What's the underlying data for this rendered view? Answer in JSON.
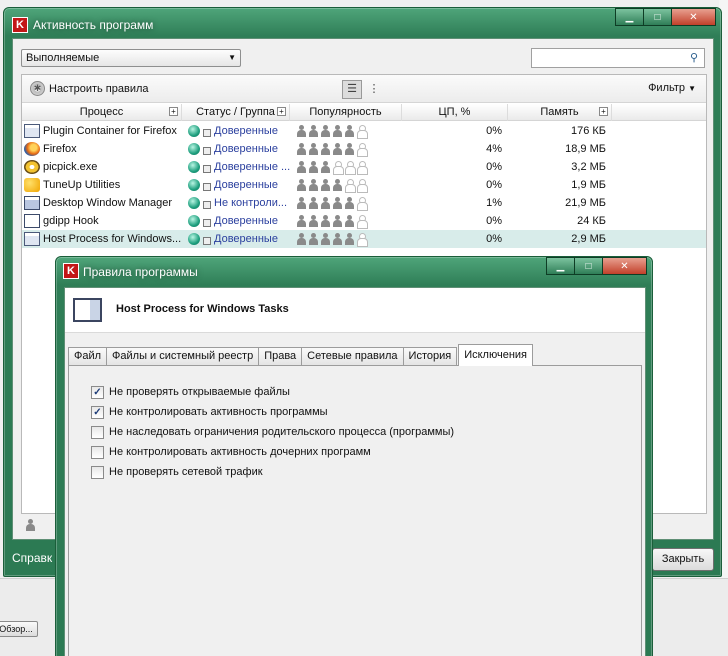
{
  "background": {
    "overview_button": "Обзор..."
  },
  "main_window": {
    "title": "Активность программ",
    "app_icon_letter": "K",
    "view_dropdown": "Выполняемые",
    "search_placeholder": "",
    "toolbar": {
      "rules_button": "Настроить правила",
      "filter_label": "Фильтр"
    },
    "columns": [
      "Процесс",
      "Статус / Группа",
      "Популярность",
      "ЦП, %",
      "Память"
    ],
    "rows": [
      {
        "process": "Plugin Container for Firefox",
        "icon": "doc-icon",
        "status": "Доверенные",
        "popularity": 5,
        "cpu": "0%",
        "memory": "176 КБ"
      },
      {
        "process": "Firefox",
        "icon": "firefox-icon",
        "status": "Доверенные",
        "popularity": 5,
        "cpu": "4%",
        "memory": "18,9 МБ"
      },
      {
        "process": "picpick.exe",
        "icon": "picpick-icon",
        "status": "Доверенные ...",
        "popularity": 3,
        "cpu": "0%",
        "memory": "3,2 МБ"
      },
      {
        "process": "TuneUp Utilities",
        "icon": "tuneup-icon",
        "status": "Доверенные",
        "popularity": 4,
        "cpu": "0%",
        "memory": "1,9 МБ"
      },
      {
        "process": "Desktop Window Manager",
        "icon": "dwm-icon",
        "status": "Не контроли...",
        "popularity": 5,
        "cpu": "1%",
        "memory": "21,9 МБ"
      },
      {
        "process": "gdipp Hook",
        "icon": "window-icon",
        "status": "Доверенные",
        "popularity": 5,
        "cpu": "0%",
        "memory": "24 КБ"
      },
      {
        "process": "Host Process for Windows...",
        "icon": "doc-icon",
        "status": "Доверенные",
        "popularity": 5,
        "cpu": "0%",
        "memory": "2,9 МБ"
      }
    ],
    "help_label": "Справк",
    "close_button": "Закрыть"
  },
  "dialog": {
    "title": "Правила программы",
    "app_name": "Host Process for Windows Tasks",
    "tabs": [
      "Файл",
      "Файлы и системный реестр",
      "Права",
      "Сетевые правила",
      "История",
      "Исключения"
    ],
    "active_tab": "Исключения",
    "options": [
      {
        "label": "Не проверять открываемые файлы",
        "checked": true
      },
      {
        "label": "Не контролировать активность программы",
        "checked": true
      },
      {
        "label": "Не наследовать ограничения родительского процесса (программы)",
        "checked": false
      },
      {
        "label": "Не контролировать активность дочерних программ",
        "checked": false
      },
      {
        "label": "Не проверять сетевой трафик",
        "checked": false
      }
    ]
  },
  "colors": {
    "window_frame": "#2f7e57",
    "selected_row": "#d8ecea",
    "status_link": "#2a3f9e"
  }
}
